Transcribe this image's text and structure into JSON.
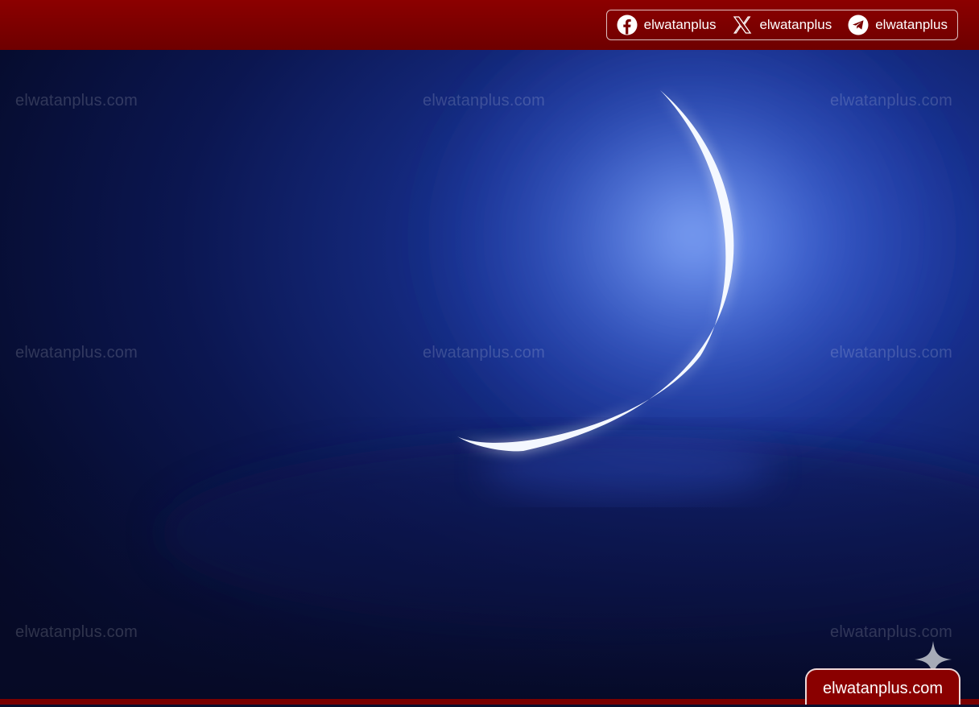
{
  "header": {
    "social": [
      {
        "icon": "facebook-icon",
        "label": "elwatanplus"
      },
      {
        "icon": "x-icon",
        "label": "elwatanplus"
      },
      {
        "icon": "telegram-icon",
        "label": "elwatanplus"
      }
    ]
  },
  "watermarks": [
    "elwatanplus.com",
    "elwatanplus.com",
    "elwatanplus.com",
    "elwatanplus.com",
    "elwatanplus.com",
    "elwatanplus.com",
    "elwatanplus.com",
    "elwatanplus.com"
  ],
  "footer": {
    "badge": "elwatanplus.com"
  },
  "colors": {
    "brand_red": "#8a0000",
    "sky": "#0a1045",
    "moon": "#ffffff"
  }
}
